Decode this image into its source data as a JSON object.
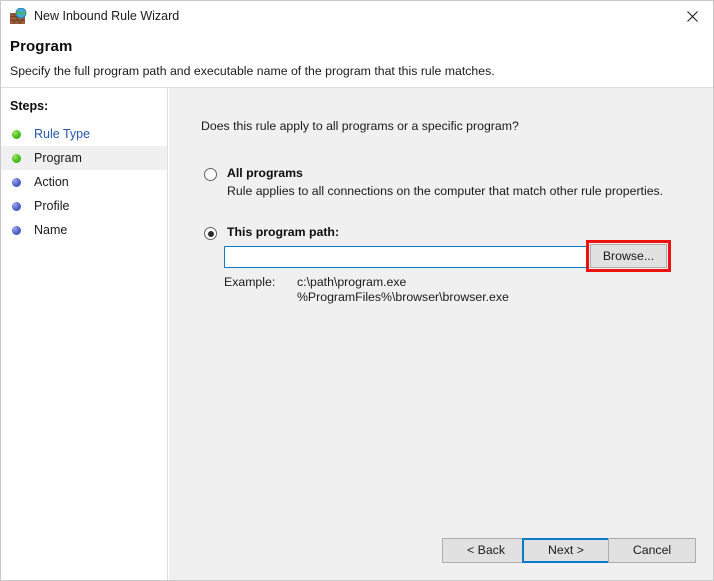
{
  "window": {
    "title": "New Inbound Rule Wizard",
    "icon": "firewall-brick-globe-icon",
    "close_label": "✕"
  },
  "header": {
    "title": "Program",
    "subtitle": "Specify the full program path and executable name of the program that this rule matches."
  },
  "sidebar": {
    "heading": "Steps:",
    "items": [
      {
        "label": "Rule Type",
        "bullet": "green",
        "state": "completed-link"
      },
      {
        "label": "Program",
        "bullet": "green",
        "state": "current"
      },
      {
        "label": "Action",
        "bullet": "blue",
        "state": "pending"
      },
      {
        "label": "Profile",
        "bullet": "blue",
        "state": "pending"
      },
      {
        "label": "Name",
        "bullet": "blue",
        "state": "pending"
      }
    ]
  },
  "main": {
    "question": "Does this rule apply to all programs or a specific program?",
    "options": [
      {
        "title": "All programs",
        "description": "Rule applies to all connections on the computer that match other rule properties.",
        "selected": false
      },
      {
        "title": "This program path:",
        "selected": true
      }
    ],
    "path_input": {
      "value": "",
      "placeholder": ""
    },
    "browse_button": "Browse...",
    "example_label": "Example:",
    "example_values": "c:\\path\\program.exe\n%ProgramFiles%\\browser\\browser.exe"
  },
  "footer": {
    "back": "< Back",
    "next": "Next >",
    "cancel": "Cancel"
  },
  "colors": {
    "accent_blue": "#0a7bc8",
    "highlight_red": "#ee1111",
    "link_blue": "#2858a8",
    "bullet_green": "#4cc321",
    "bullet_blue": "#5566cc",
    "panel_gray": "#f0f0f0",
    "button_face": "#e1e1e1"
  }
}
